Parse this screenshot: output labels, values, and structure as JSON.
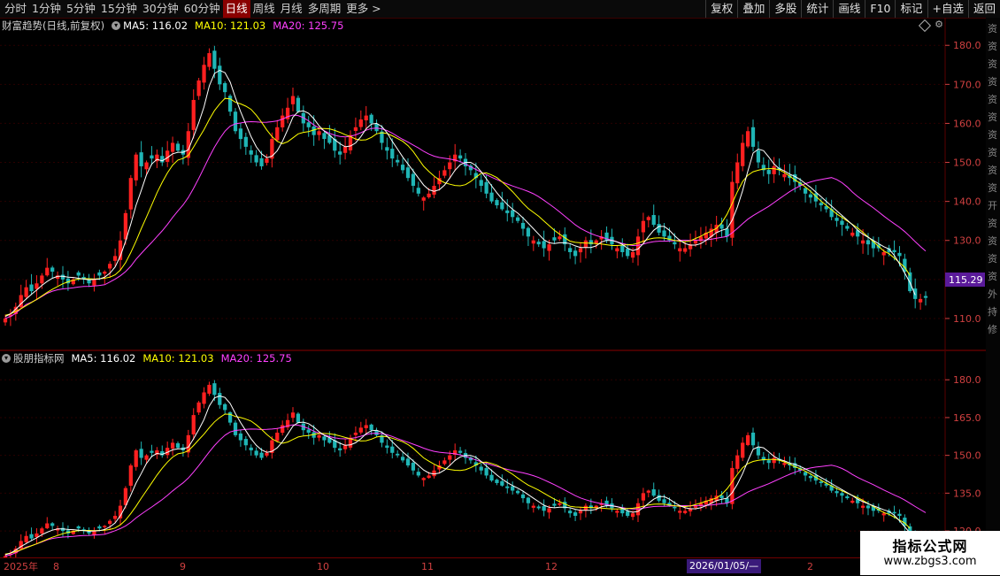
{
  "toolbar": {
    "periods": [
      "分时",
      "1分钟",
      "5分钟",
      "15分钟",
      "30分钟",
      "60分钟",
      "日线",
      "周线",
      "月线",
      "多周期",
      "更多 >"
    ],
    "active_period": "日线",
    "buttons": [
      "复权",
      "叠加",
      "多股",
      "统计",
      "画线",
      "F10",
      "标记",
      "+自选",
      "返回"
    ]
  },
  "main_panel": {
    "title": "财富趋势(日线,前复权)",
    "ma5": "MA5: 116.02",
    "ma10": "MA10: 121.03",
    "ma20": "MA20: 125.75",
    "current_price": "115.29"
  },
  "indicator_panel": {
    "title": "股朋指标网",
    "ma5": "MA5: 116.02",
    "ma10": "MA10: 121.03",
    "ma20": "MA20: 125.75"
  },
  "colors": {
    "up": "#ff2020",
    "down": "#1fb5b5",
    "ma5": "#ffffff",
    "ma10": "#ffff00",
    "ma20": "#ff40ff",
    "axis_text": "#d04040",
    "grid": "#5a0000"
  },
  "date_axis": {
    "labels": [
      "2025年",
      "8",
      "9",
      "10",
      "11",
      "12",
      "2"
    ],
    "cursor_date": "2026/01/05/—"
  },
  "right_strip_text": "资资资资资资资资资资开资资资资外持修",
  "watermark": {
    "line1": "指标公式网",
    "line2": "www.zbgs3.com"
  },
  "chart_data": [
    {
      "type": "candlestick",
      "title": "财富趋势(日线,前复权)",
      "y_ticks": [
        180.0,
        170.0,
        160.0,
        150.0,
        140.0,
        130.0,
        120.0,
        110.0
      ],
      "y_tick_labels": [
        "180.0",
        "170.0",
        "160.0",
        "150.0",
        "140.0",
        "130.0",
        "120.0",
        "110.0"
      ],
      "ylim": [
        105,
        183
      ],
      "last_close": 115.29,
      "ma_values": {
        "MA5": 116.02,
        "MA10": 121.03,
        "MA20": 125.75
      },
      "close": [
        110,
        111,
        113,
        116,
        118,
        117,
        119,
        121,
        123,
        122,
        121,
        120,
        119,
        120,
        121,
        120,
        119,
        120,
        121,
        122,
        124,
        126,
        130,
        137,
        146,
        152,
        149,
        150,
        151,
        152,
        150,
        153,
        155,
        153,
        152,
        158,
        166,
        171,
        175,
        178,
        174,
        170,
        168,
        163,
        158,
        156,
        154,
        152,
        150,
        149,
        151,
        156,
        159,
        162,
        164,
        167,
        163,
        160,
        159,
        157,
        158,
        156,
        155,
        153,
        152,
        154,
        157,
        159,
        161,
        162,
        160,
        158,
        155,
        153,
        151,
        150,
        148,
        146,
        144,
        142,
        141,
        142,
        144,
        146,
        148,
        150,
        152,
        151,
        149,
        148,
        146,
        144,
        142,
        140,
        139,
        138,
        137,
        136,
        135,
        133,
        131,
        130,
        129,
        128,
        129,
        130,
        131,
        129,
        127,
        126,
        128,
        130,
        129,
        130,
        131,
        130,
        129,
        128,
        127,
        126,
        127,
        131,
        135,
        136,
        134,
        132,
        131,
        130,
        129,
        128,
        128,
        129,
        130,
        131,
        132,
        133,
        134,
        133,
        131,
        145,
        150,
        155,
        158,
        154,
        150,
        148,
        147,
        149,
        148,
        147,
        146,
        145,
        144,
        142,
        141,
        140,
        139,
        138,
        136,
        135,
        134,
        133,
        132,
        131,
        130,
        129,
        128,
        128,
        127,
        127,
        127,
        126,
        122,
        117,
        115,
        115,
        115.29
      ],
      "ma5": [
        110.5,
        111.2,
        112.4,
        113.8,
        115.0,
        116.2,
        117.3,
        118.5,
        119.5,
        120.3,
        120.8,
        120.8,
        120.6,
        120.5,
        120.3,
        120.1,
        119.9,
        120.0,
        120.1,
        120.6,
        121.6,
        123.2,
        126.0,
        129.8,
        134.2,
        139.0,
        142.8,
        146.8,
        149.6,
        150.8,
        150.4,
        151.2,
        152.2,
        152.6,
        152.6,
        153.2,
        156.6,
        160.2,
        164.2,
        169.6,
        172.8,
        173.6,
        173.0,
        170.6,
        166.6,
        163.0,
        159.8,
        156.6,
        154.0,
        152.2,
        151.2,
        151.6,
        153.0,
        155.4,
        158.4,
        161.6,
        163.0,
        163.2,
        162.6,
        161.2,
        159.4,
        158.0,
        157.0,
        155.8,
        154.8,
        154.0,
        154.2,
        155.0,
        156.6,
        158.6,
        159.8,
        160.0,
        159.2,
        157.6,
        155.4,
        153.4,
        151.4,
        149.6,
        147.8,
        146.0,
        144.2,
        143.0,
        142.6,
        143.0,
        144.2,
        146.0,
        148.0,
        149.4,
        150.0,
        150.0,
        149.2,
        147.6,
        145.8,
        144.0,
        142.2,
        140.6,
        139.2,
        138.0,
        137.0,
        135.8,
        134.4,
        133.0,
        131.6,
        130.2,
        129.4,
        129.2,
        129.4,
        129.4,
        129.2,
        128.6,
        128.2,
        128.2,
        128.2,
        128.6,
        129.6,
        130.0,
        130.0,
        129.6,
        129.0,
        128.0,
        127.4,
        127.8,
        129.2,
        131.0,
        132.6,
        133.6,
        133.6,
        132.6,
        131.2,
        130.0,
        129.2,
        128.8,
        128.8,
        129.2,
        130.0,
        131.0,
        132.0,
        132.6,
        133.0,
        135.2,
        138.6,
        142.8,
        147.8,
        152.4,
        153.4,
        153.0,
        151.4,
        149.6,
        148.4,
        147.8,
        147.0,
        146.4,
        145.6,
        144.6,
        143.6,
        142.4,
        141.2,
        140.0,
        138.8,
        137.6,
        136.4,
        135.2,
        134.0,
        132.6,
        131.6,
        130.8,
        130.0,
        129.2,
        128.4,
        127.8,
        126.2,
        124.0,
        121.6,
        119.2,
        116.0
      ],
      "ma10": [
        110.8,
        111.2,
        111.8,
        112.5,
        113.3,
        114.1,
        114.9,
        115.8,
        116.7,
        117.5,
        118.2,
        118.9,
        119.4,
        119.8,
        120.1,
        120.2,
        120.2,
        120.1,
        120.2,
        120.3,
        120.6,
        121.2,
        122.4,
        124.3,
        126.9,
        129.8,
        133.0,
        136.0,
        139.1,
        142.2,
        144.9,
        147.3,
        149.3,
        150.6,
        151.0,
        151.8,
        153.9,
        156.2,
        158.4,
        161.0,
        163.3,
        165.0,
        166.4,
        166.3,
        165.4,
        165.0,
        164.4,
        163.6,
        162.1,
        160.3,
        158.3,
        156.6,
        155.4,
        154.8,
        155.3,
        156.3,
        157.3,
        157.7,
        157.9,
        158.3,
        158.7,
        158.7,
        158.6,
        158.2,
        157.7,
        157.1,
        156.6,
        156.0,
        155.7,
        155.8,
        156.4,
        157.3,
        157.6,
        157.4,
        156.8,
        156.1,
        155.4,
        154.3,
        152.8,
        150.9,
        149.0,
        147.7,
        146.5,
        145.5,
        144.8,
        144.4,
        144.1,
        144.0,
        144.3,
        145.1,
        146.2,
        147.2,
        147.3,
        146.8,
        146.1,
        145.0,
        143.8,
        142.5,
        141.0,
        139.5,
        138.2,
        137.2,
        136.2,
        135.0,
        133.8,
        132.6,
        131.6,
        130.7,
        129.8,
        129.5,
        129.4,
        129.3,
        129.3,
        129.2,
        129.1,
        128.9,
        128.7,
        128.7,
        128.8,
        128.9,
        129.0,
        129.3,
        129.8,
        130.3,
        130.6,
        130.7,
        130.6,
        130.3,
        130.0,
        129.8,
        129.7,
        129.9,
        130.5,
        131.1,
        131.8,
        132.4,
        133.1,
        134.5,
        136.7,
        139.5,
        142.5,
        145.1,
        146.7,
        147.6,
        148.0,
        148.3,
        148.4,
        148.4,
        148.1,
        147.4,
        146.5,
        145.5,
        144.7,
        143.7,
        142.6,
        141.3,
        140.1,
        139.0,
        137.9,
        136.8,
        135.9,
        135.0,
        134.1,
        133.2,
        132.1,
        130.9,
        129.7,
        128.5,
        127.3,
        126.6,
        125.5,
        124.3,
        123.1,
        121.0
      ]
    },
    {
      "type": "candlestick",
      "title": "股朋指标网",
      "y_ticks": [
        180.0,
        165.0,
        150.0,
        135.0,
        120.0
      ],
      "y_tick_labels": [
        "180.0",
        "165.0",
        "150.0",
        "135.0",
        "120.0"
      ],
      "ylim": [
        113,
        185
      ],
      "ma_values": {
        "MA5": 116.02,
        "MA10": 121.03,
        "MA20": 125.75
      }
    }
  ]
}
